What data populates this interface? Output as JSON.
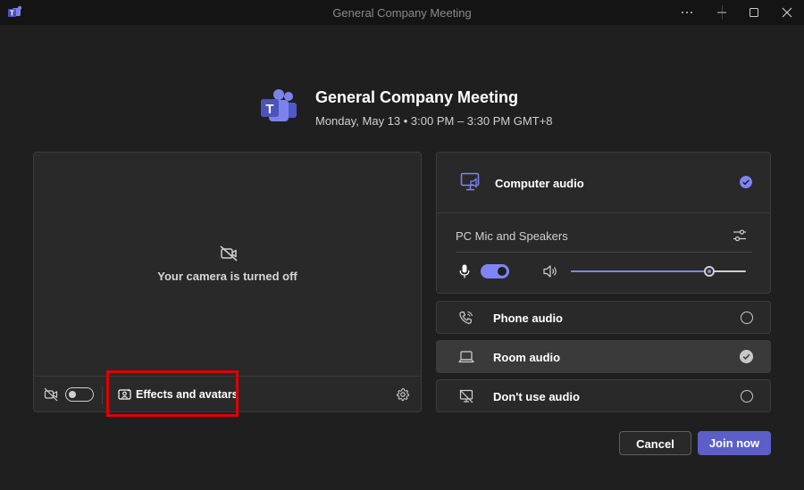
{
  "window": {
    "title": "General Company Meeting",
    "icon": "teams-app-icon",
    "controls": [
      "more-options-icon",
      "minimize-icon",
      "maximize-icon",
      "close-icon"
    ]
  },
  "meeting": {
    "title": "General Company Meeting",
    "time": "Monday, May 13 • 3:00 PM  –  3:30 PM GMT+8",
    "logo": "teams-logo"
  },
  "video": {
    "camera_off_text": "Your camera is turned off",
    "camera_toggle_on": false,
    "effects_label": "Effects and avatars",
    "icons": [
      "camera-off-icon",
      "video-off-icon",
      "effects-icon",
      "gear-icon"
    ]
  },
  "audio": {
    "computer": {
      "label": "Computer audio",
      "selected": true,
      "device_label": "PC Mic and Speakers",
      "mic_on": true,
      "volume_fraction": 0.79
    },
    "options": [
      {
        "label": "Phone audio",
        "icon": "phone-icon",
        "state": "unselected"
      },
      {
        "label": "Room audio",
        "icon": "laptop-icon",
        "state": "checked"
      },
      {
        "label": "Don't use audio",
        "icon": "no-audio-icon",
        "state": "unselected"
      }
    ]
  },
  "buttons": {
    "cancel": "Cancel",
    "join": "Join now"
  },
  "colors": {
    "background": "#1f1f1f",
    "panel": "#292929",
    "accent": "#7f85f5",
    "primary_button": "#5b5fc7",
    "highlight": "#e00000"
  }
}
